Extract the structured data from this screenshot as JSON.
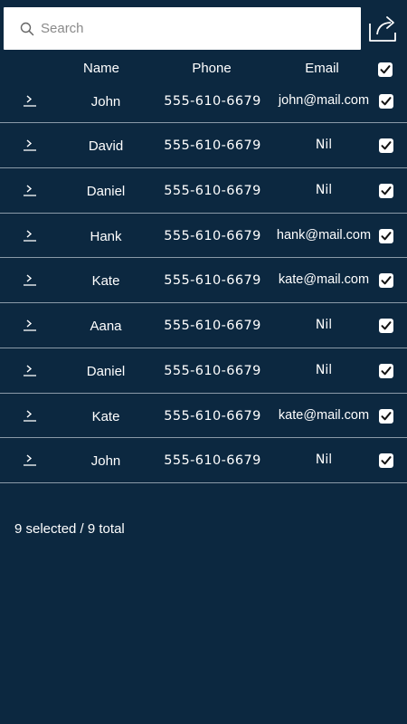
{
  "search": {
    "placeholder": "Search"
  },
  "header": {
    "name": "Name",
    "phone": "Phone",
    "email": "Email"
  },
  "rows": [
    {
      "name": "John",
      "phone": "555-610-6679",
      "email": "john@mail.com"
    },
    {
      "name": "David",
      "phone": "555-610-6679",
      "email": "Nil"
    },
    {
      "name": "Daniel",
      "phone": "555-610-6679",
      "email": "Nil"
    },
    {
      "name": "Hank",
      "phone": "555-610-6679",
      "email": "hank@mail.com"
    },
    {
      "name": "Kate",
      "phone": "555-610-6679",
      "email": "kate@mail.com"
    },
    {
      "name": "Aana",
      "phone": "555-610-6679",
      "email": "Nil"
    },
    {
      "name": "Daniel",
      "phone": "555-610-6679",
      "email": "Nil"
    },
    {
      "name": "Kate",
      "phone": "555-610-6679",
      "email": "kate@mail.com"
    },
    {
      "name": "John",
      "phone": "555-610-6679",
      "email": "Nil"
    }
  ],
  "status": {
    "text": "9 selected / 9 total"
  },
  "icons": {
    "search": "search-icon",
    "share": "share-icon",
    "row_expand": "chevron-right-icon",
    "check": "checkmark-icon"
  },
  "colors": {
    "background": "#0c2840",
    "text": "#ffffff",
    "divider": "#8a9aa8"
  }
}
